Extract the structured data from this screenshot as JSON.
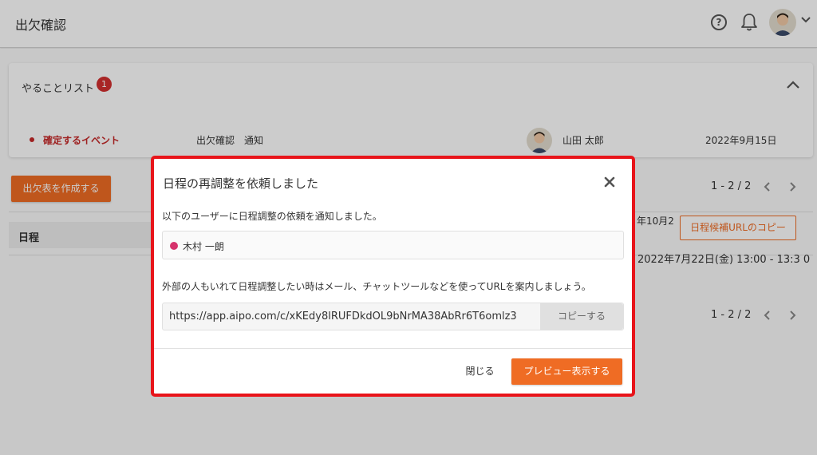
{
  "header": {
    "title": "出欠確認",
    "help_glyph": "?",
    "icons": [
      "help-icon",
      "bell-icon",
      "avatar",
      "chevron-down-icon"
    ]
  },
  "todo": {
    "title": "やることリスト",
    "badge_count": "1",
    "item": {
      "event": "確定するイベント",
      "type": "出欠確認　通知",
      "user": "山田 太郎",
      "date": "2022年9月15日"
    }
  },
  "toolbar": {
    "create_label": "出欠表を作成する",
    "pager_top": "1 - 2 / 2",
    "pager_bottom": "1 - 2 / 2"
  },
  "table": {
    "header_label": "日程",
    "row1_date": "年10月2",
    "row1_copy_label": "日程候補URLのコピー",
    "row2_date": "2022年7月22日(金) 13:00 - 13:3 0"
  },
  "modal": {
    "title": "日程の再調整を依頼しました",
    "message": "以下のユーザーに日程調整の依頼を通知しました。",
    "user": "木村 一朗",
    "external_message": "外部の人もいれて日程調整したい時はメール、チャットツールなどを使ってURLを案内しましょう。",
    "url": "https://app.aipo.com/c/xKEdy8lRUFDkdOL9bNrMA38AbRr6T6omlz3",
    "copy_label": "コピーする",
    "close_label": "閉じる",
    "preview_label": "プレビュー表示する"
  },
  "colors": {
    "accent": "#ef6c24",
    "danger": "#c62828",
    "highlight": "#e8141a",
    "user_dot": "#d6336c"
  }
}
